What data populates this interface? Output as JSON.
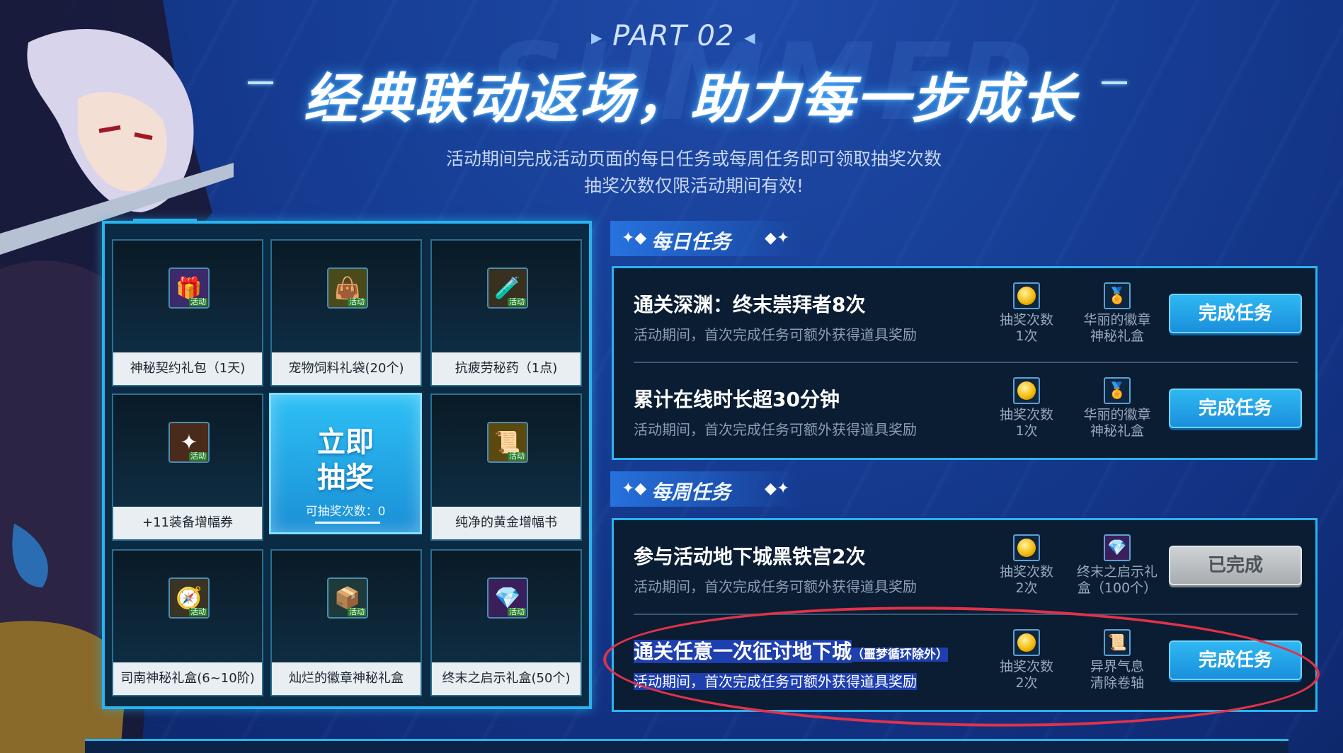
{
  "header": {
    "part_label": "PART 02",
    "title": "经典联动返场，助力每一步成长",
    "subtitle_line1": "活动期间完成活动页面的每日任务或每周任务即可领取抽奖次数",
    "subtitle_line2": "抽奖次数仅限活动期间有效!"
  },
  "grid": {
    "items": [
      {
        "label": "神秘契约礼包（1天)",
        "icon": "gift-pack-icon",
        "tag": "活动"
      },
      {
        "label": "宠物饲料礼袋(20个)",
        "icon": "pet-food-bag-icon",
        "tag": "活动"
      },
      {
        "label": "抗疲劳秘药（1点)",
        "icon": "potion-bottle-icon",
        "tag": "活动"
      },
      {
        "label": "+11装备增幅券",
        "icon": "upgrade-ticket-icon",
        "tag": "活动"
      },
      {
        "label": "纯净的黄金增幅书",
        "icon": "golden-book-icon",
        "tag": "活动"
      },
      {
        "label": "司南神秘礼盒(6~10阶)",
        "icon": "compass-box-icon",
        "tag": "活动"
      },
      {
        "label": "灿烂的徽章神秘礼盒",
        "icon": "badge-box-icon",
        "tag": "活动"
      },
      {
        "label": "终末之启示礼盒(50个)",
        "icon": "revelation-box-icon",
        "tag": "活动"
      }
    ],
    "draw": {
      "line1": "立即",
      "line2": "抽奖",
      "count_label": "可抽奖次数：0"
    }
  },
  "daily": {
    "heading": "每日任务",
    "tasks": [
      {
        "name": "通关深渊：终末崇拜者8次",
        "desc": "活动期间，首次完成任务可额外获得道具奖励",
        "r1a": "抽奖次数",
        "r1b": "1次",
        "r2a": "华丽的徽章",
        "r2b": "神秘礼盒",
        "button": "完成任务"
      },
      {
        "name": "累计在线时长超30分钟",
        "desc": "活动期间，首次完成任务可额外获得道具奖励",
        "r1a": "抽奖次数",
        "r1b": "1次",
        "r2a": "华丽的徽章",
        "r2b": "神秘礼盒",
        "button": "完成任务"
      }
    ]
  },
  "weekly": {
    "heading": "每周任务",
    "tasks": [
      {
        "name": "参与活动地下城黑铁宫2次",
        "desc": "活动期间，首次完成任务可额外获得道具奖励",
        "r1a": "抽奖次数",
        "r1b": "2次",
        "r2a": "终末之启示礼",
        "r2b": "盒（100个）",
        "button": "已完成"
      },
      {
        "name": "通关任意一次征讨地下城",
        "name_note": "（噩梦循环除外）",
        "desc": "活动期间，首次完成任务可额外获得道具奖励",
        "r1a": "抽奖次数",
        "r1b": "2次",
        "r2a": "异界气息",
        "r2b": "清除卷轴",
        "button": "完成任务"
      }
    ]
  },
  "colors": {
    "accent": "#2ab4ef",
    "highlight_circle": "#e0324a",
    "background": "#123080"
  }
}
